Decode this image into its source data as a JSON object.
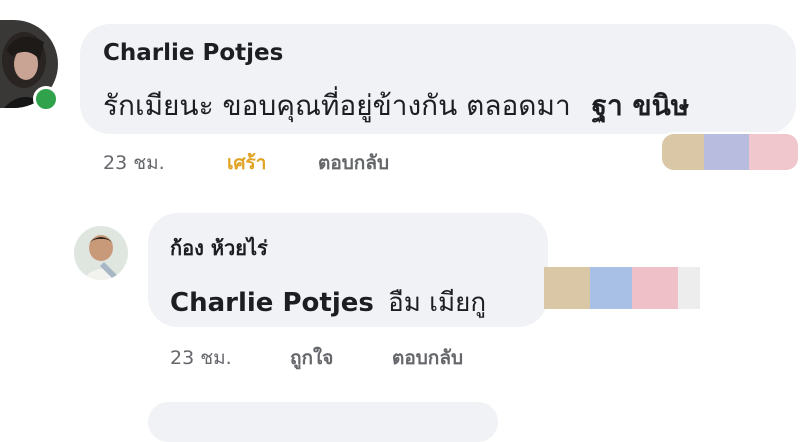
{
  "comment1": {
    "author": "Charlie Potjes",
    "text": "รักเมียนะ ขอบคุณที่อยู่ข้างกัน ตลอดมา",
    "tag": "ฐา ขนิษ",
    "time": "23 ชม.",
    "reaction": "เศร้า",
    "reply_label": "ตอบกลับ",
    "reaction_color": "#e0a324",
    "online": true,
    "online_color": "#31a24c",
    "redaction_colors": [
      "#d9c7a5",
      "#b8bde0",
      "#efc7cc"
    ]
  },
  "comment2": {
    "author": "ก้อง ห้วยไร่",
    "mention": "Charlie Potjes",
    "text": "อืม เมียกู",
    "time": "23 ชม.",
    "like_label": "ถูกใจ",
    "reply_label": "ตอบกลับ",
    "redaction_colors": [
      "#d9c7a5",
      "#a9c0e6",
      "#efc0c7",
      "#ededed"
    ]
  }
}
